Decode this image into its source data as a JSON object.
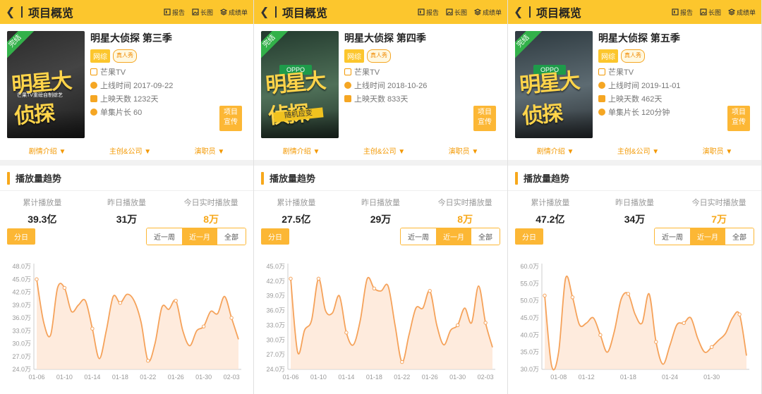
{
  "panels": [
    {
      "header": {
        "title": "项目概览",
        "report": "报告",
        "long_image": "长图",
        "scorecard": "成绩单"
      },
      "poster": {
        "ribbon": "完结",
        "art_text": "明星大侦探",
        "art_sub": "芒果TV重磅自制综艺"
      },
      "show": {
        "title": "明星大侦探 第三季",
        "tag_type": "网综",
        "tag_genre": "真人秀",
        "platform": "芒果TV",
        "release": "上线时间 2017-09-22",
        "days": "上映天数 1232天",
        "episode_len": "单集片长 60"
      },
      "promo": {
        "line1": "项目",
        "line2": "宣传"
      },
      "subnav": {
        "plot": "剧情介绍 ▼",
        "creators": "主创&公司 ▼",
        "cast": "演职员 ▼"
      },
      "trend": {
        "title": "播放量趋势",
        "total_label": "累计播放量",
        "total": "39.3亿",
        "yday_label": "昨日播放量",
        "yday": "31万",
        "today_label": "今日实时播放量",
        "today": "8万"
      },
      "controls": {
        "by_day": "分日",
        "week": "近一周",
        "month": "近一月",
        "all": "全部"
      }
    },
    {
      "header": {
        "title": "项目概览",
        "report": "报告",
        "long_image": "长图",
        "scorecard": "成绩单"
      },
      "poster": {
        "ribbon": "完结",
        "art_text": "明星大侦探",
        "art_sub": "OPPO",
        "art_badge": "随机应变"
      },
      "show": {
        "title": "明星大侦探 第四季",
        "tag_type": "网综",
        "tag_genre": "真人秀",
        "platform": "芒果TV",
        "release": "上线时间 2018-10-26",
        "days": "上映天数 833天",
        "episode_len": ""
      },
      "promo": {
        "line1": "项目",
        "line2": "宣传"
      },
      "subnav": {
        "plot": "剧情介绍 ▼",
        "creators": "主创&公司 ▼",
        "cast": "演职员 ▼"
      },
      "trend": {
        "title": "播放量趋势",
        "total_label": "累计播放量",
        "total": "27.5亿",
        "yday_label": "昨日播放量",
        "yday": "29万",
        "today_label": "今日实时播放量",
        "today": "8万"
      },
      "controls": {
        "by_day": "分日",
        "week": "近一周",
        "month": "近一月",
        "all": "全部"
      }
    },
    {
      "header": {
        "title": "项目概览",
        "report": "报告",
        "long_image": "长图",
        "scorecard": "成绩单"
      },
      "poster": {
        "ribbon": "完结",
        "art_text": "明星大侦探",
        "art_sub": "OPPO"
      },
      "show": {
        "title": "明星大侦探 第五季",
        "tag_type": "网综",
        "tag_genre": "真人秀",
        "platform": "芒果TV",
        "release": "上线时间 2019-11-01",
        "days": "上映天数 462天",
        "episode_len": "单集片长 120分钟"
      },
      "promo": {
        "line1": "项目",
        "line2": "宣传"
      },
      "subnav": {
        "plot": "剧情介绍 ▼",
        "creators": "主创&公司 ▼",
        "cast": "演职员 ▼"
      },
      "trend": {
        "title": "播放量趋势",
        "total_label": "累计播放量",
        "total": "47.2亿",
        "yday_label": "昨日播放量",
        "yday": "34万",
        "today_label": "今日实时播放量",
        "today": "7万"
      },
      "controls": {
        "by_day": "分日",
        "week": "近一周",
        "month": "近一月",
        "all": "全部"
      }
    }
  ],
  "colors": {
    "brand_yellow": "#fcc62d",
    "accent_orange": "#f7a81b",
    "line": "#f5a25a",
    "fill": "#fde3cf"
  },
  "chart_data": [
    {
      "type": "area",
      "yticks": [
        "24.0万",
        "27.0万",
        "30.0万",
        "33.0万",
        "36.0万",
        "39.0万",
        "42.0万",
        "45.0万",
        "48.0万"
      ],
      "ylim": [
        24,
        48
      ],
      "xticks": [
        "01-06",
        "01-10",
        "01-14",
        "01-18",
        "01-22",
        "01-26",
        "01-30",
        "02-03"
      ],
      "x": [
        "01-06",
        "01-07",
        "01-08",
        "01-09",
        "01-10",
        "01-11",
        "01-12",
        "01-13",
        "01-14",
        "01-15",
        "01-16",
        "01-17",
        "01-18",
        "01-19",
        "01-20",
        "01-21",
        "01-22",
        "01-23",
        "01-24",
        "01-25",
        "01-26",
        "01-27",
        "01-28",
        "01-29",
        "01-30",
        "01-31",
        "02-01",
        "02-02",
        "02-03",
        "02-04"
      ],
      "values": [
        45,
        35,
        32,
        43,
        43,
        37.5,
        39,
        40,
        33.5,
        26.5,
        33,
        41,
        39.5,
        41.5,
        40,
        35,
        26,
        30,
        38.5,
        38,
        40,
        33,
        29.5,
        33,
        34,
        37.5,
        37,
        41,
        36,
        31
      ]
    },
    {
      "type": "area",
      "yticks": [
        "24.0万",
        "27.0万",
        "30.0万",
        "33.0万",
        "36.0万",
        "39.0万",
        "42.0万",
        "45.0万"
      ],
      "ylim": [
        24,
        45
      ],
      "xticks": [
        "01-06",
        "01-10",
        "01-14",
        "01-18",
        "01-22",
        "01-26",
        "01-30",
        "02-03"
      ],
      "x": [
        "01-06",
        "01-07",
        "01-08",
        "01-09",
        "01-10",
        "01-11",
        "01-12",
        "01-13",
        "01-14",
        "01-15",
        "01-16",
        "01-17",
        "01-18",
        "01-19",
        "01-20",
        "01-21",
        "01-22",
        "01-23",
        "01-24",
        "01-25",
        "01-26",
        "01-27",
        "01-28",
        "01-29",
        "01-30",
        "01-31",
        "02-01",
        "02-02",
        "02-03",
        "02-04"
      ],
      "values": [
        42.5,
        27.5,
        32,
        34,
        42.5,
        36,
        35.5,
        39,
        31.5,
        29,
        34,
        42.5,
        40.5,
        40,
        41,
        33,
        25.5,
        31,
        36.5,
        36.5,
        40,
        33,
        29,
        32,
        33,
        36.5,
        33.5,
        41,
        33.5,
        28.5
      ]
    },
    {
      "type": "area",
      "yticks": [
        "30.0万",
        "35.0万",
        "40.0万",
        "45.0万",
        "50.0万",
        "55.0万",
        "60.0万"
      ],
      "ylim": [
        30,
        60
      ],
      "xticks": [
        "01-08",
        "01-12",
        "01-18",
        "01-24",
        "01-30"
      ],
      "x": [
        "01-06",
        "01-07",
        "01-08",
        "01-09",
        "01-10",
        "01-11",
        "01-12",
        "01-13",
        "01-14",
        "01-15",
        "01-16",
        "01-17",
        "01-18",
        "01-19",
        "01-20",
        "01-21",
        "01-22",
        "01-23",
        "01-24",
        "01-25",
        "01-26",
        "01-27",
        "01-28",
        "01-29",
        "01-30",
        "01-31",
        "02-01",
        "02-02",
        "02-03",
        "02-04"
      ],
      "values": [
        51.5,
        31,
        35,
        56.5,
        51,
        43,
        43.5,
        45,
        40,
        35,
        41,
        50.5,
        52,
        46,
        43.5,
        52,
        38,
        31.5,
        37,
        43,
        43.5,
        45,
        39,
        35,
        36.5,
        38.5,
        40.5,
        45,
        46,
        34
      ]
    }
  ]
}
